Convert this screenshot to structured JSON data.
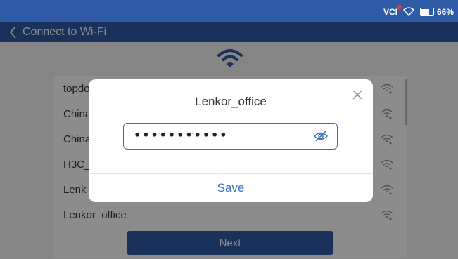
{
  "status_bar": {
    "vci_label": "VCI",
    "battery_label": "66%",
    "colors": {
      "bar": "#2e5aa6",
      "vci_dot": "#e53935"
    },
    "icons": [
      "wifi-icon",
      "battery-icon"
    ]
  },
  "app_bar": {
    "title": "Connect to Wi-Fi",
    "icons": [
      "chevron-left-icon"
    ]
  },
  "main": {
    "networks": [
      {
        "name": "topdon"
      },
      {
        "name": "China"
      },
      {
        "name": "China"
      },
      {
        "name": "H3C_"
      },
      {
        "name": "Lenk"
      },
      {
        "name": "Lenkor_office"
      }
    ],
    "next_label": "Next"
  },
  "dialog": {
    "title": "Lenkor_office",
    "password_value": "•••••••••••",
    "save_label": "Save",
    "icons": [
      "close-icon",
      "eye-off-icon"
    ],
    "accent": "#3a6dbf"
  }
}
